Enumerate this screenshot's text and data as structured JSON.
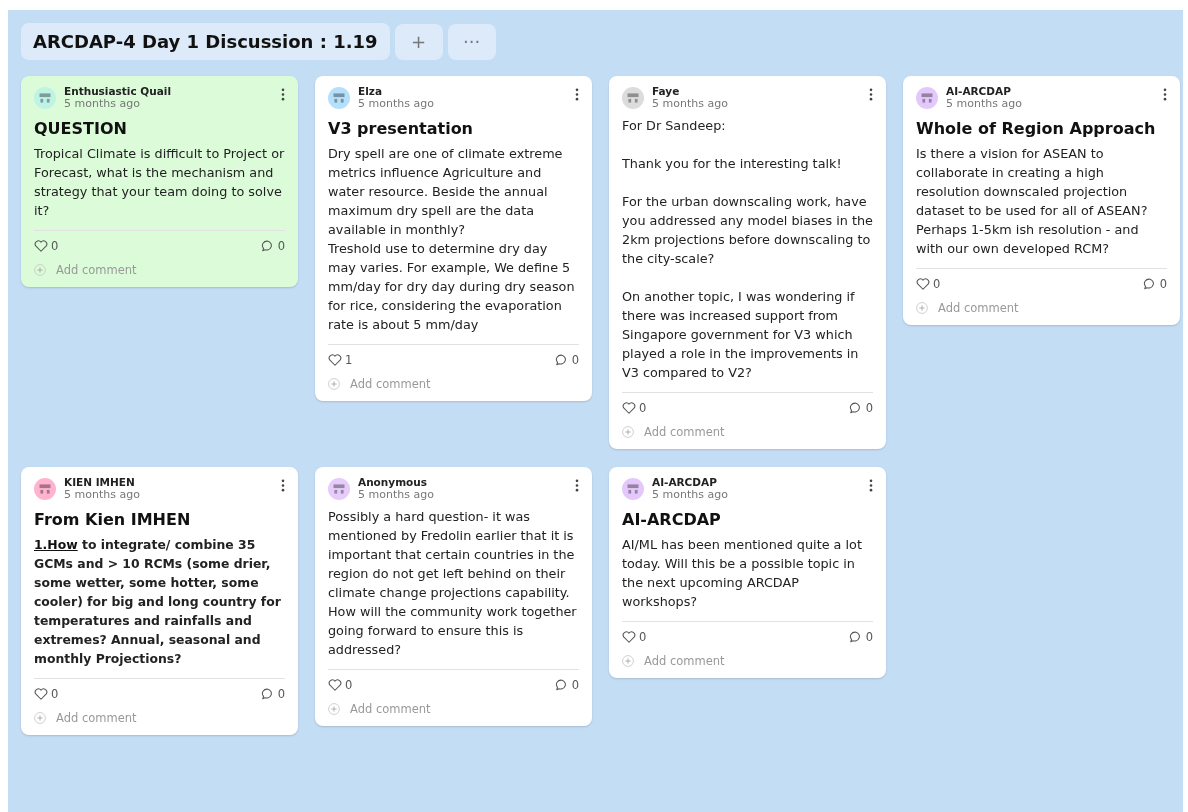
{
  "board": {
    "title": "ARCDAP-4 Day 1 Discussion : 1.19",
    "add_tab": "+",
    "more_tab": "···"
  },
  "columns": [
    {
      "cards": [
        {
          "author": "Enthusiastic Quail",
          "time": "5 months ago",
          "avatar": {
            "color": "#bff3e6"
          },
          "color": "#dcfcd9",
          "title": "QUESTION",
          "body_bold": false,
          "body": "Tropical Climate is difficult to Project or Forecast, what is the mechanism and strategy that your team doing to solve it?",
          "likes": "0",
          "comments": "0",
          "add_comment": "Add comment"
        },
        {
          "author": "KIEN IMHEN",
          "time": "5 months ago",
          "avatar": {
            "color": "#ffb3cf"
          },
          "color": "#ffffff",
          "title": "From Kien IMHEN",
          "body_bold": true,
          "body_link": "1.How",
          "body": " to integrate/ combine 35 GCMs and > 10 RCMs (some drier, some wetter, some hotter, some cooler) for big and long country for temperatures and rainfalls and extremes?  Annual, seasonal and monthly Projections?",
          "likes": "0",
          "comments": "0",
          "add_comment": "Add comment"
        }
      ]
    },
    {
      "cards": [
        {
          "author": "Elza",
          "time": "5 months ago",
          "avatar": {
            "color": "#b5e0fb"
          },
          "color": "#ffffff",
          "title": "V3 presentation",
          "body_bold": false,
          "body": "Dry spell are one of climate extreme metrics influence Agriculture and water resource. Beside the annual maximum dry spell  are the data available in monthly?\nTreshold use to determine dry day may varies.  For example, We define  5 mm/day for dry day during dry season for rice, considering the evaporation rate is about 5 mm/day",
          "likes": "1",
          "comments": "0",
          "add_comment": "Add comment"
        },
        {
          "author": "Anonymous",
          "time": "5 months ago",
          "avatar": {
            "color": "#e6ccfb"
          },
          "color": "#ffffff",
          "body_bold": false,
          "body": "Possibly a hard question- it was mentioned by Fredolin earlier that it is important that certain countries in the region do not get left behind on their climate change projections capability. How will the community work together going forward to ensure this is addressed?",
          "likes": "0",
          "comments": "0",
          "add_comment": "Add comment"
        }
      ]
    },
    {
      "cards": [
        {
          "author": "Faye",
          "time": "5 months ago",
          "avatar": {
            "color": "#dcdcdc"
          },
          "color": "#ffffff",
          "body_bold": false,
          "body": "For Dr Sandeep:\n\nThank you for the interesting talk!\n\nFor the urban downscaling work, have you addressed any model biases in the 2km projections before downscaling to the city-scale?\n\nOn another topic, I was wondering if there was increased support from Singapore government for V3 which played a role in the improvements in V3 compared to V2?",
          "likes": "0",
          "comments": "0",
          "add_comment": "Add comment"
        },
        {
          "author": "AI-ARCDAP",
          "time": "5 months ago",
          "avatar": {
            "color": "#e4c8fb"
          },
          "color": "#ffffff",
          "title": "AI-ARCDAP",
          "body_bold": false,
          "body": "AI/ML has been mentioned quite a lot today. Will this be a possible topic in the next upcoming ARCDAP workshops?",
          "likes": "0",
          "comments": "0",
          "add_comment": "Add comment"
        }
      ]
    },
    {
      "cards": [
        {
          "author": "AI-ARCDAP",
          "time": "5 months ago",
          "avatar": {
            "color": "#e4c8fb"
          },
          "color": "#ffffff",
          "title": "Whole of Region Approach",
          "body_bold": false,
          "body": "Is there a vision for ASEAN to collaborate in creating a high resolution downscaled projection dataset to be used for all of ASEAN? Perhaps 1-5km ish resolution - and with our own developed RCM?",
          "likes": "0",
          "comments": "0",
          "add_comment": "Add comment"
        }
      ]
    }
  ]
}
